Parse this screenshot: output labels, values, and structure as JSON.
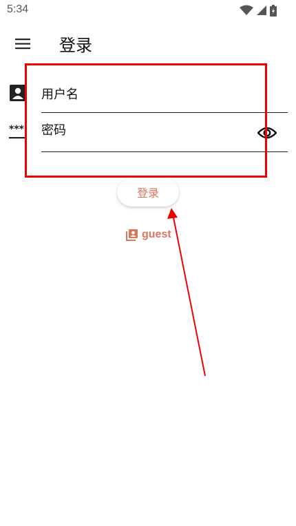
{
  "status_bar": {
    "time": "5:34",
    "icons": [
      "wifi-icon",
      "signal-icon",
      "battery-icon"
    ]
  },
  "app_bar": {
    "menu_icon": "menu-icon",
    "title": "登录"
  },
  "form": {
    "username": {
      "icon": "account-box-icon",
      "placeholder": "用户名",
      "value": ""
    },
    "password": {
      "icon": "password-icon",
      "placeholder": "密码",
      "value": "",
      "toggle_icon": "eye-icon"
    }
  },
  "actions": {
    "login_label": "登录",
    "guest_label": "guest",
    "guest_icon": "account-box-outline-icon"
  },
  "colors": {
    "accent": "#d9775e",
    "annotation": "#ee0000",
    "text": "#111111"
  }
}
